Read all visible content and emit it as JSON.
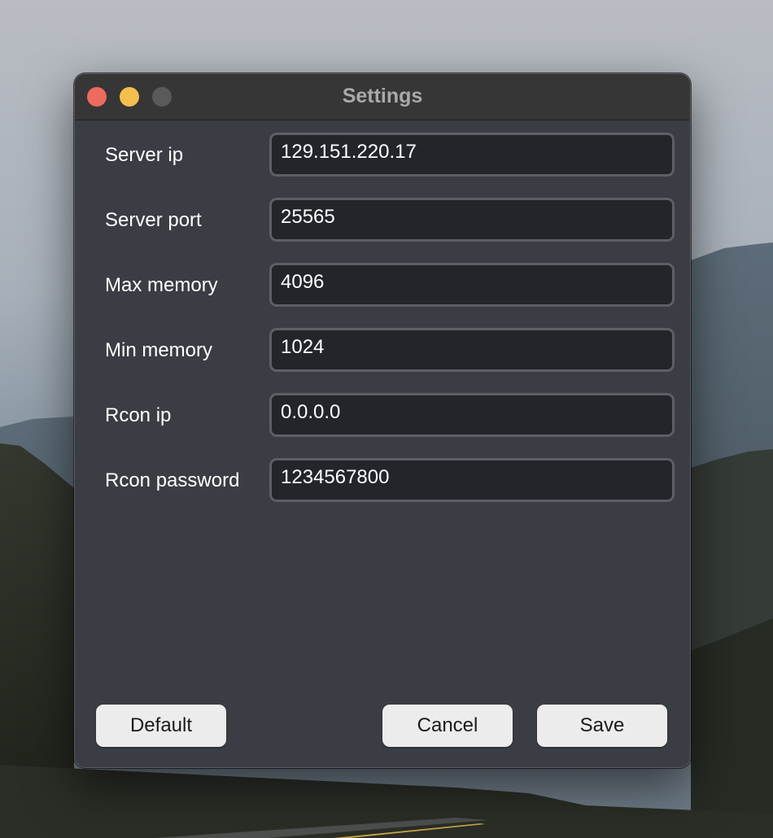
{
  "window": {
    "title": "Settings"
  },
  "fields": [
    {
      "label": "Server ip",
      "value": "129.151.220.17"
    },
    {
      "label": "Server port",
      "value": "25565"
    },
    {
      "label": "Max memory",
      "value": "4096"
    },
    {
      "label": "Min memory",
      "value": "1024"
    },
    {
      "label": "Rcon ip",
      "value": "0.0.0.0"
    },
    {
      "label": "Rcon password",
      "value": "1234567800"
    }
  ],
  "buttons": {
    "default_label": "Default",
    "cancel_label": "Cancel",
    "save_label": "Save"
  },
  "colors": {
    "window_bg": "#3a3d44",
    "titlebar_bg": "#363636",
    "input_bg": "#23252b",
    "input_border": "#5c5f66",
    "close_button": "#ed6a5e",
    "minimize_button": "#f5bf4f",
    "zoom_button_disabled": "#5a5a5a",
    "button_bg": "#ececec"
  }
}
